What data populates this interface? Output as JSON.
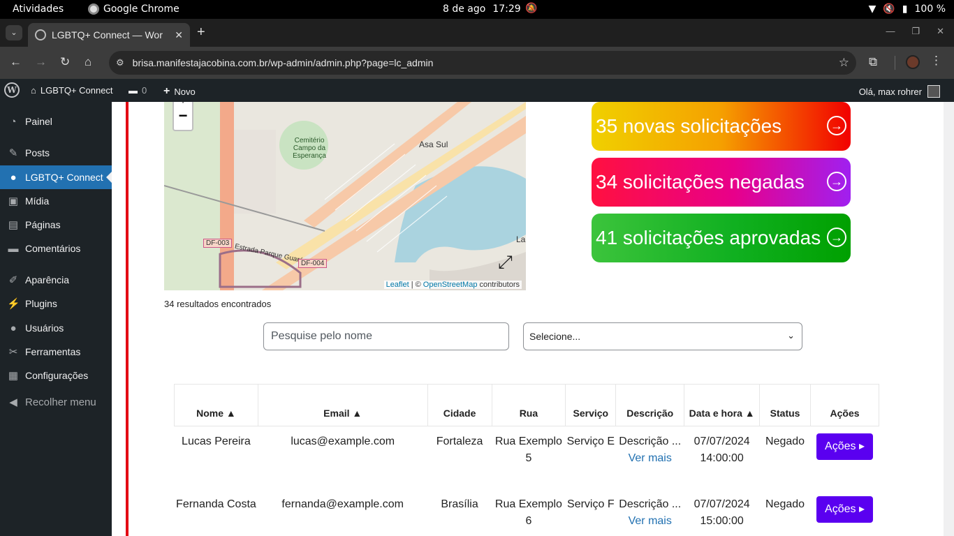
{
  "os_bar": {
    "activities": "Atividades",
    "app": "Google Chrome",
    "date": "8 de ago",
    "time": "17:29",
    "battery": "100 %"
  },
  "browser": {
    "tab_title": "LGBTQ+ Connect — Wor",
    "url": "brisa.manifestajacobina.com.br/wp-admin/admin.php?page=lc_admin"
  },
  "admin_bar": {
    "site": "LGBTQ+ Connect",
    "comments": "0",
    "new": "Novo",
    "howdy": "Olá, max rohrer"
  },
  "sidebar": {
    "items": [
      {
        "label": "Painel",
        "icon": "dashboard-icon"
      },
      {
        "label": "Posts",
        "icon": "pin-icon"
      },
      {
        "label": "LGBTQ+ Connect",
        "icon": "user-icon"
      },
      {
        "label": "Mídia",
        "icon": "media-icon"
      },
      {
        "label": "Páginas",
        "icon": "page-icon"
      },
      {
        "label": "Comentários",
        "icon": "comment-icon"
      },
      {
        "label": "Aparência",
        "icon": "brush-icon"
      },
      {
        "label": "Plugins",
        "icon": "plug-icon"
      },
      {
        "label": "Usuários",
        "icon": "users-icon"
      },
      {
        "label": "Ferramentas",
        "icon": "wrench-icon"
      },
      {
        "label": "Configurações",
        "icon": "settings-icon"
      }
    ],
    "collapse": "Recolher menu"
  },
  "map": {
    "zoom_out": "−",
    "labels": {
      "cemetery": "Cemitério Campo da Esperança",
      "asa_sul": "Asa Sul",
      "df003": "DF-003",
      "df004": "DF-004",
      "estrada": "Estrada Parque Guará",
      "la": "La"
    },
    "attribution": {
      "leaflet": "Leaflet",
      "osm": "OpenStreetMap",
      "contributors": "contributors"
    }
  },
  "stats": {
    "new": "35 novas solicitações",
    "denied": "34 solicitações negadas",
    "approved": "41 solicitações aprovadas"
  },
  "results_count": "34 resultados encontrados",
  "search": {
    "placeholder": "Pesquise pelo nome"
  },
  "filter": {
    "selected": "Selecione..."
  },
  "table": {
    "headers": {
      "name": "Nome ▲",
      "email": "Email ▲",
      "city": "Cidade",
      "street": "Rua",
      "service": "Serviço",
      "description": "Descrição",
      "datetime": "Data e hora ▲",
      "status": "Status",
      "actions": "Ações"
    },
    "rows": [
      {
        "name": "Lucas Pereira",
        "email": "lucas@example.com",
        "city": "Fortaleza",
        "street": "Rua Exemplo 5",
        "service": "Serviço E",
        "description": "Descrição ...",
        "more": "Ver mais",
        "date": "07/07/2024",
        "time": "14:00:00",
        "status": "Negado",
        "actions": "Ações ▸"
      },
      {
        "name": "Fernanda Costa",
        "email": "fernanda@example.com",
        "city": "Brasília",
        "street": "Rua Exemplo 6",
        "service": "Serviço F",
        "description": "Descrição ...",
        "more": "Ver mais",
        "date": "07/07/2024",
        "time": "15:00:00",
        "status": "Negado",
        "actions": "Ações ▸"
      }
    ]
  }
}
